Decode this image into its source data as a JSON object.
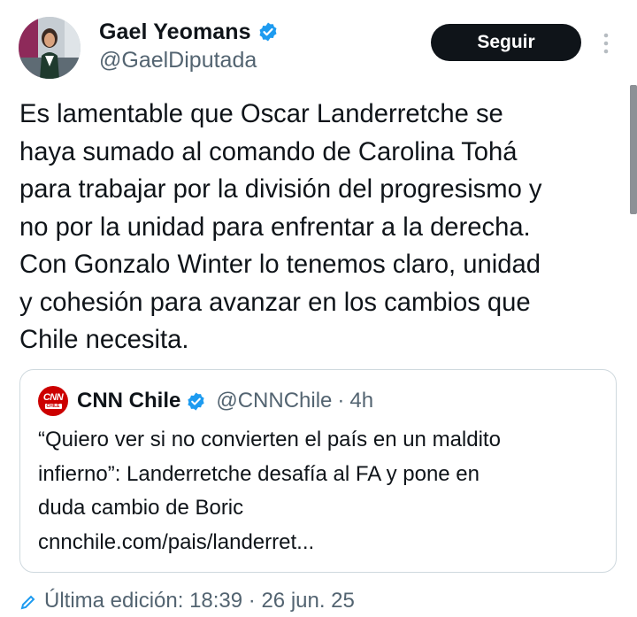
{
  "author": {
    "display_name": "Gael Yeomans",
    "handle": "@GaelDiputada",
    "verified": true
  },
  "follow_button": {
    "label": "Seguir"
  },
  "tweet": {
    "text": "Es lamentable que Oscar Landerretche se\nhaya sumado al comando de Carolina Tohá\npara trabajar por la división del progresismo y\nno por la unidad para enfrentar a la derecha.\nCon Gonzalo Winter lo tenemos claro, unidad\ny cohesión para avanzar en los cambios que\nChile necesita."
  },
  "quote": {
    "avatar_text": "CNN",
    "avatar_subtext": "CHILE",
    "display_name": "CNN Chile",
    "handle": "@CNNChile",
    "separator": "·",
    "time": "4h",
    "text": "“Quiero ver si no convierten el país en un maldito\ninfierno”: Landerretche desafía al FA y pone en\nduda cambio de Boric\ncnnchile.com/pais/landerret..."
  },
  "edited": {
    "label": "Última edición: 18:39 · 26 jun. 25"
  },
  "icons": {
    "verified": "verified-badge-icon",
    "more": "more-options-icon",
    "edit": "edit-pencil-icon"
  },
  "colors": {
    "verified_blue": "#1d9bf0",
    "follow_bg": "#0f1419",
    "secondary_text": "#536471",
    "cnn_red": "#cc0000"
  }
}
